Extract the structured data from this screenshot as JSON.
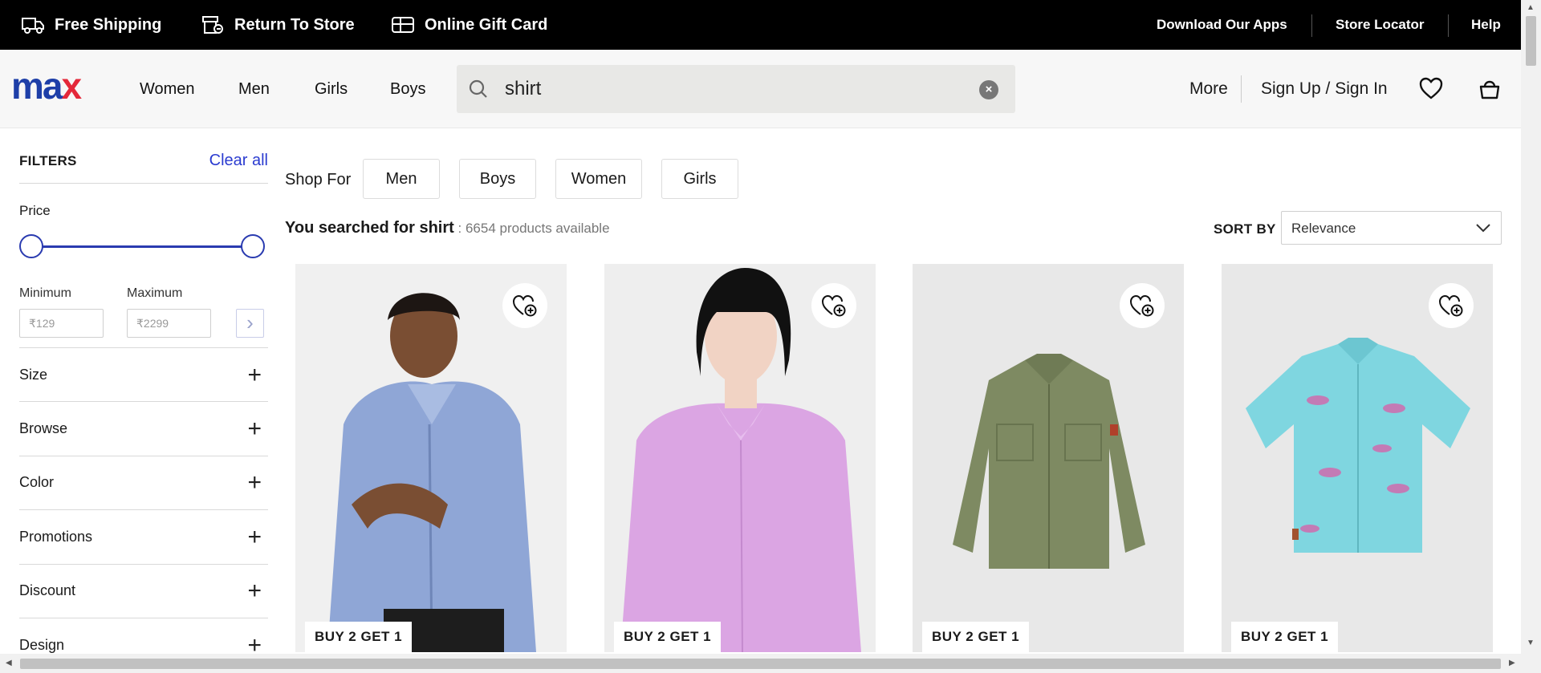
{
  "topbar": {
    "free_shipping": "Free Shipping",
    "return_to_store": "Return To Store",
    "online_gift_card": "Online Gift Card",
    "download_apps": "Download Our Apps",
    "store_locator": "Store Locator",
    "help": "Help"
  },
  "header": {
    "logo_left": "ma",
    "logo_right": "x",
    "nav": [
      "Women",
      "Men",
      "Girls",
      "Boys"
    ],
    "search_value": "shirt",
    "more": "More",
    "sign_in": "Sign Up / Sign In"
  },
  "filters": {
    "title": "FILTERS",
    "clear_all": "Clear all",
    "price_label": "Price",
    "min_label": "Minimum",
    "max_label": "Maximum",
    "min_placeholder": "₹129",
    "max_placeholder": "₹2299",
    "sections": [
      "Size",
      "Browse",
      "Color",
      "Promotions",
      "Discount",
      "Design"
    ]
  },
  "shop_for": {
    "label": "Shop For",
    "chips": [
      "Men",
      "Boys",
      "Women",
      "Girls"
    ]
  },
  "results": {
    "prefix": "You searched for shirt",
    "count": " : 6654 products available",
    "sort_label": "SORT BY",
    "sort_value": "Relevance"
  },
  "products": [
    {
      "promo": "BUY 2 GET 1",
      "icon": "heart-plus-icon"
    },
    {
      "promo": "BUY 2 GET 1",
      "icon": "heart-plus-icon"
    },
    {
      "promo": "BUY 2 GET 1",
      "icon": "heart-plus-icon"
    },
    {
      "promo": "BUY 2 GET 1",
      "icon": "heart-plus-icon"
    }
  ],
  "colors": {
    "brand_blue": "#1e3fa8",
    "brand_red": "#e4283a",
    "link_blue": "#2a3bd0"
  }
}
